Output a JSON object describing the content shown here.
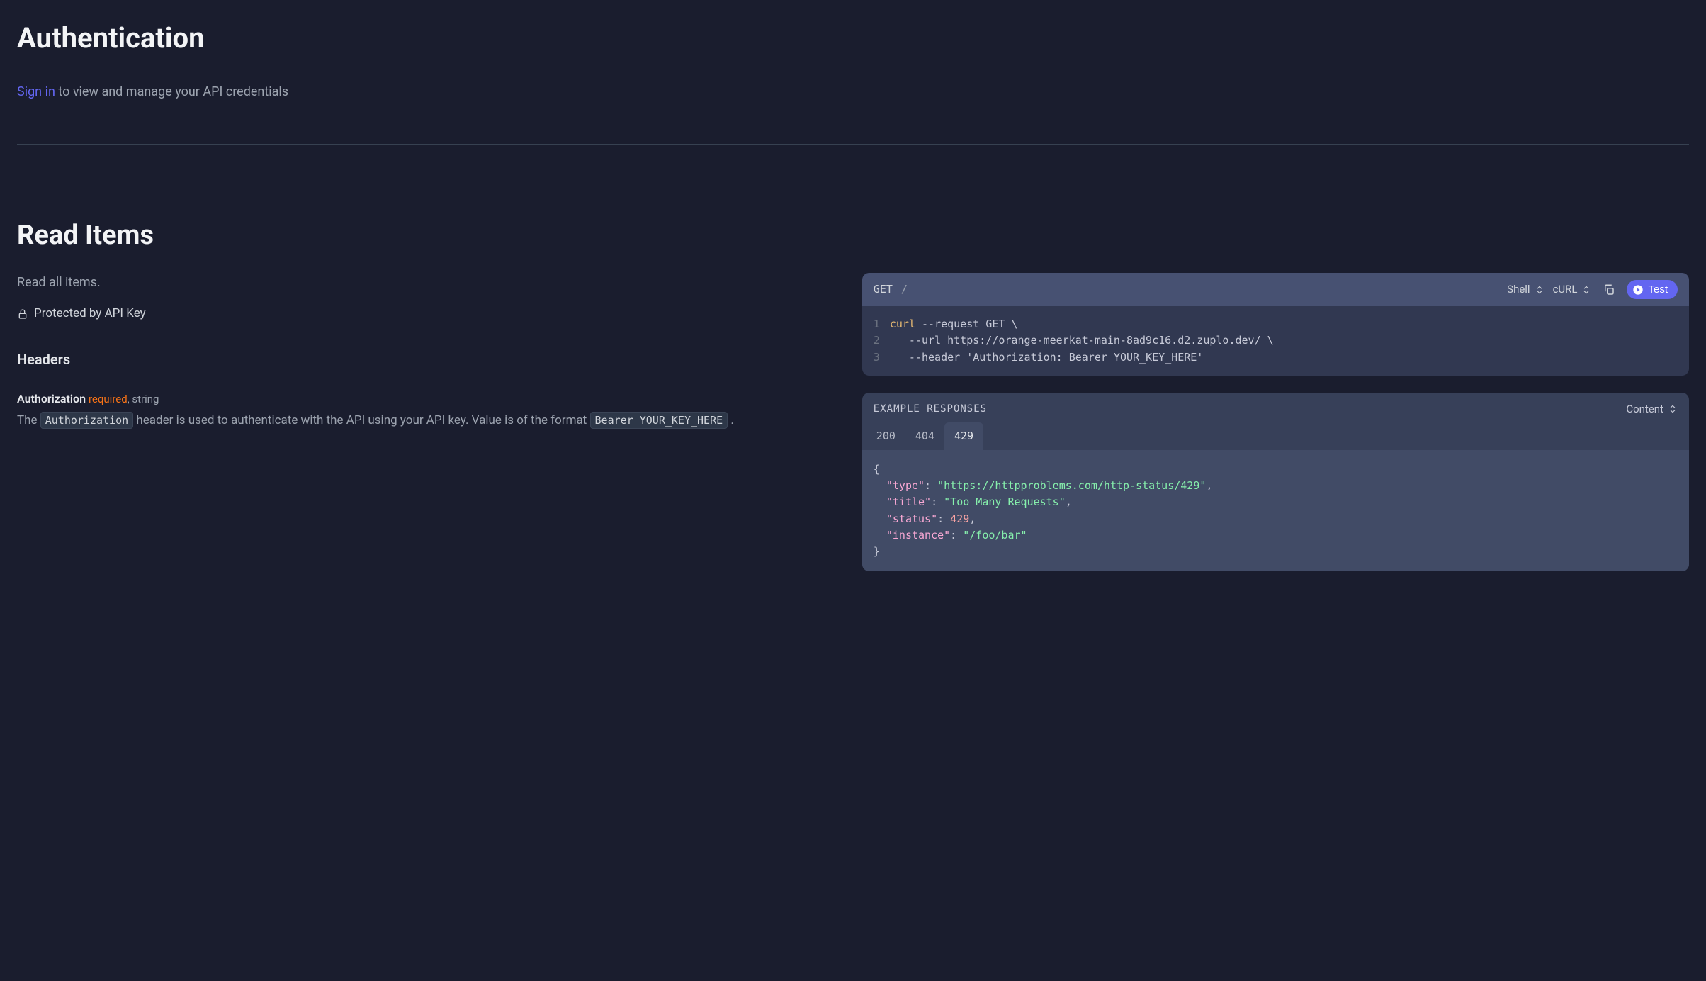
{
  "auth": {
    "title": "Authentication",
    "signin": "Sign in",
    "rest": " to view and manage your API credentials"
  },
  "section": {
    "title": "Read Items",
    "desc": "Read all items.",
    "protected": "Protected by API Key",
    "headersTitle": "Headers"
  },
  "param": {
    "name": "Authorization",
    "required": "required",
    "sep": ", ",
    "type": "string",
    "d1": "The ",
    "code1": "Authorization",
    "d2": " header is used to authenticate with the API using your API key. Value is of the format ",
    "code2": "Bearer YOUR_KEY_HERE",
    "d3": " ."
  },
  "req": {
    "method": "GET",
    "path": "/",
    "lang": "Shell",
    "tool": "cURL",
    "test": "Test",
    "lines": {
      "n1": "1",
      "n2": "2",
      "n3": "3",
      "cmd": "curl",
      "l1r": " --request GET \\",
      "l2": "   --url https://orange-meerkat-main-8ad9c16.d2.zuplo.dev/ \\",
      "l3a": "   --header ",
      "l3b": "'Authorization: Bearer YOUR_KEY_HERE'"
    }
  },
  "resp": {
    "label": "EXAMPLE RESPONSES",
    "content": "Content",
    "tabs": {
      "t200": "200",
      "t404": "404",
      "t429": "429"
    },
    "json": {
      "open": "{",
      "k_type": "\"type\"",
      "v_type": "\"https://httpproblems.com/http-status/429\"",
      "k_title": "\"title\"",
      "v_title": "\"Too Many Requests\"",
      "k_status": "\"status\"",
      "v_status": "429",
      "k_instance": "\"instance\"",
      "v_instance": "\"/foo/bar\"",
      "close": "}"
    }
  }
}
